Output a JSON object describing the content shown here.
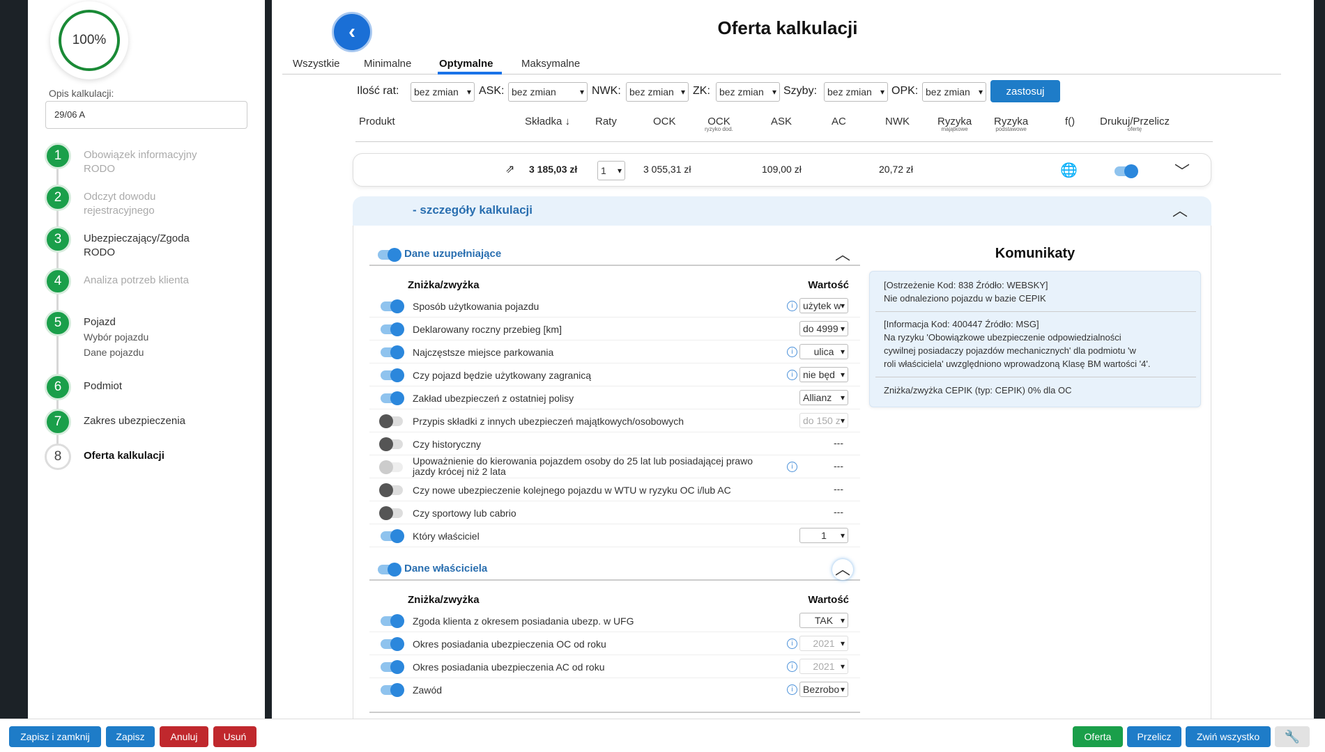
{
  "sidebar": {
    "progress": "100%",
    "desc_label": "Opis kalkulacji:",
    "desc_value": "29/06 A",
    "steps": [
      {
        "num": "1",
        "label": "Obowiązek informacyjny RODO"
      },
      {
        "num": "2",
        "label": "Odczyt dowodu rejestracyjnego"
      },
      {
        "num": "3",
        "label": "Ubezpieczający/Zgoda RODO"
      },
      {
        "num": "4",
        "label": "Analiza potrzeb klienta"
      },
      {
        "num": "5",
        "label": "Pojazd",
        "sub1": "Wybór pojazdu",
        "sub2": "Dane pojazdu"
      },
      {
        "num": "6",
        "label": "Podmiot"
      },
      {
        "num": "7",
        "label": "Zakres ubezpieczenia"
      },
      {
        "num": "8",
        "label": "Oferta kalkulacji"
      }
    ]
  },
  "header": {
    "title": "Oferta kalkulacji"
  },
  "tabs": [
    "Wszystkie",
    "Minimalne",
    "Optymalne",
    "Maksymalne"
  ],
  "filters": {
    "ilosc_rat_label": "Ilość rat:",
    "ilosc_rat": "bez zmian",
    "ask_label": "ASK:",
    "ask": "bez zmian",
    "nwk_label": "NWK:",
    "nwk": "bez zmian",
    "zk_label": "ZK:",
    "zk": "bez zmian",
    "szyby_label": "Szyby:",
    "szyby": "bez zmian",
    "opk_label": "OPK:",
    "opk": "bez zmian",
    "apply": "zastosuj"
  },
  "columns": {
    "produkt": "Produkt",
    "skladka": "Składka ↓",
    "raty": "Raty",
    "ock": "OCK",
    "ock2": "OCK",
    "ock2_sub": "ryzyko dod.",
    "ask": "ASK",
    "ac": "AC",
    "nwk": "NWK",
    "rm": "Ryzyka",
    "rm_sub": "majątkowe",
    "rp": "Ryzyka",
    "rp_sub": "podstawowe",
    "f": "f()",
    "druk": "Drukuj/Przelicz",
    "druk_sub": "ofertę"
  },
  "result": {
    "skladka": "3 185,03 zł",
    "raty": "1",
    "ock": "3 055,31 zł",
    "ask": "109,00 zł",
    "nwk": "20,72 zł"
  },
  "details": {
    "title": "- szczegóły kalkulacji"
  },
  "sec1": {
    "title": "Dane uzupełniające",
    "col_a": "Zniżka/zwyżka",
    "col_b": "Wartość",
    "rows": [
      {
        "label": "Sposób użytkowania pojazdu",
        "value": "użytek w"
      },
      {
        "label": "Deklarowany roczny przebieg [km]",
        "value": "do 4999"
      },
      {
        "label": "Najczęstsze miejsce parkowania",
        "value": "ulica"
      },
      {
        "label": "Czy pojazd będzie użytkowany zagranicą",
        "value": "nie będ"
      },
      {
        "label": "Zakład ubezpieczeń z ostatniej polisy",
        "value": "Allianz"
      },
      {
        "label": "Przypis składki z innych ubezpieczeń majątkowych/osobowych",
        "value": "do 150 z"
      },
      {
        "label": "Czy historyczny",
        "value": "---"
      },
      {
        "label": "Upoważnienie do kierowania pojazdem osoby do 25 lat lub posiadającej prawo jazdy krócej niż 2 lata",
        "value": "---"
      },
      {
        "label": "Czy nowe ubezpieczenie kolejnego pojazdu w WTU w ryzyku OC i/lub AC",
        "value": "---"
      },
      {
        "label": "Czy sportowy lub cabrio",
        "value": "---"
      },
      {
        "label": "Który właściciel",
        "value": "1"
      }
    ]
  },
  "sec2": {
    "title": "Dane właściciela",
    "col_a": "Zniżka/zwyżka",
    "col_b": "Wartość",
    "rows": [
      {
        "label": "Zgoda klienta z okresem posiadania ubezp. w UFG",
        "value": "TAK"
      },
      {
        "label": "Okres posiadania ubezpieczenia OC od roku",
        "value": "2021"
      },
      {
        "label": "Okres posiadania ubezpieczenia AC od roku",
        "value": "2021"
      },
      {
        "label": "Zawód",
        "value": "Bezrobo"
      }
    ]
  },
  "komunikaty": {
    "title": "Komunikaty",
    "m1a": "[Ostrzeżenie Kod: 838 Źródło: WEBSKY]",
    "m1b": "Nie odnaleziono pojazdu w bazie CEPIK",
    "m2a": "[Informacja Kod: 400447 Źródło: MSG]",
    "m2b": "Na ryzyku 'Obowiązkowe ubezpieczenie odpowiedzialności",
    "m2c": "cywilnej posiadaczy pojazdów mechanicznych' dla podmiotu 'w",
    "m2d": "roli właściciela' uwzględniono wprowadzoną Klasę BM wartości '4'.",
    "m3": "Zniżka/zwyżka CEPIK (typ: CEPIK) 0% dla OC"
  },
  "bottom": {
    "save_close": "Zapisz i zamknij",
    "save": "Zapisz",
    "cancel": "Anuluj",
    "delete": "Usuń",
    "offer": "Oferta",
    "recalc": "Przelicz",
    "collapse": "Zwiń wszystko"
  }
}
